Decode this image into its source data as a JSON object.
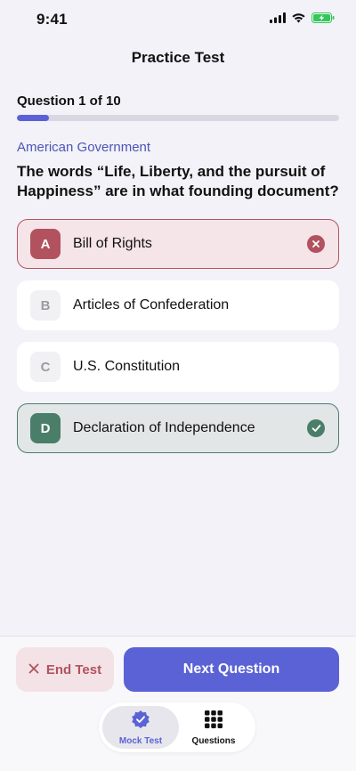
{
  "status_bar": {
    "time": "9:41",
    "icons": [
      "signal-icon",
      "wifi-icon",
      "battery-charging-icon"
    ],
    "battery_color": "#34c759"
  },
  "header": {
    "title": "Practice Test"
  },
  "progress": {
    "label": "Question 1 of 10",
    "current": 1,
    "total": 10,
    "fraction": 0.1,
    "fill_color": "#5b62d6"
  },
  "question": {
    "category": "American Government",
    "text": "The words “Life, Liberty, and the pursuit of Happiness” are in what founding document?"
  },
  "answers": [
    {
      "letter": "A",
      "text": "Bill of Rights",
      "state": "wrong",
      "icon": "x-circle-icon"
    },
    {
      "letter": "B",
      "text": "Articles of Confederation",
      "state": "neutral"
    },
    {
      "letter": "C",
      "text": "U.S. Constitution",
      "state": "neutral"
    },
    {
      "letter": "D",
      "text": "Declaration of Independence",
      "state": "correct",
      "icon": "check-circle-icon"
    }
  ],
  "actions": {
    "end_label": "End Test",
    "end_icon": "close-icon",
    "next_label": "Next Question"
  },
  "tabs": [
    {
      "label": "Mock Test",
      "icon": "badge-check-icon",
      "active": true
    },
    {
      "label": "Questions",
      "icon": "grid-icon",
      "active": false
    }
  ],
  "colors": {
    "accent": "#5b62d6",
    "wrong": "#b2525f",
    "correct": "#4a7e69",
    "background": "#f3f2f8"
  }
}
